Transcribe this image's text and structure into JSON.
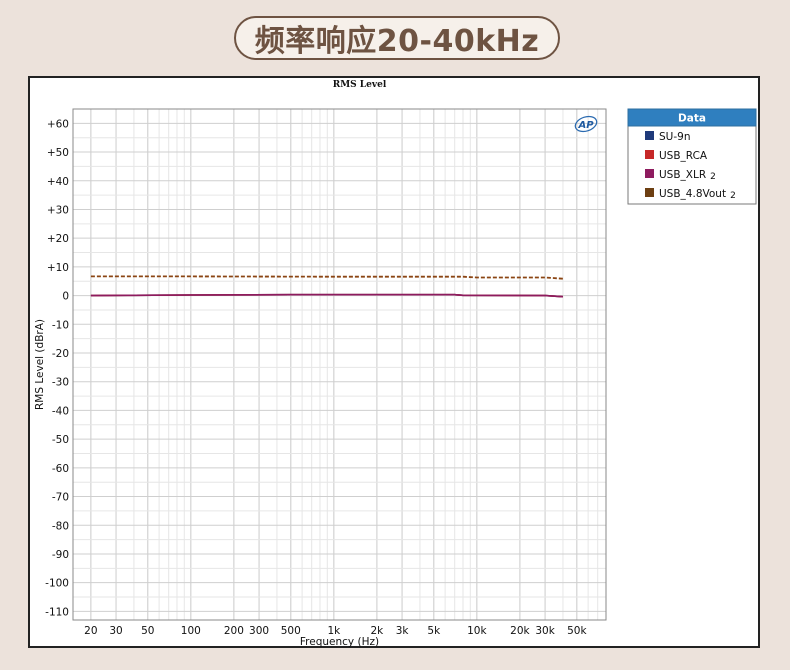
{
  "page": {
    "heading": "频率响应20-40kHz"
  },
  "chart_data": {
    "type": "line",
    "title": "RMS Level",
    "xlabel": "Frequency (Hz)",
    "ylabel": "RMS Level (dBrA)",
    "x_scale": "log",
    "xlim": [
      15,
      80000
    ],
    "ylim": [
      -113,
      65
    ],
    "grid": true,
    "legend_position": "outside-right",
    "logo_text": "AP",
    "x_ticks": [
      {
        "value": 20,
        "label": "20"
      },
      {
        "value": 30,
        "label": "30"
      },
      {
        "value": 50,
        "label": "50"
      },
      {
        "value": 100,
        "label": "100"
      },
      {
        "value": 200,
        "label": "200"
      },
      {
        "value": 300,
        "label": "300"
      },
      {
        "value": 500,
        "label": "500"
      },
      {
        "value": 1000,
        "label": "1k"
      },
      {
        "value": 2000,
        "label": "2k"
      },
      {
        "value": 3000,
        "label": "3k"
      },
      {
        "value": 5000,
        "label": "5k"
      },
      {
        "value": 10000,
        "label": "10k"
      },
      {
        "value": 20000,
        "label": "20k"
      },
      {
        "value": 30000,
        "label": "30k"
      },
      {
        "value": 50000,
        "label": "50k"
      }
    ],
    "y_ticks": [
      {
        "value": 60,
        "label": "+60"
      },
      {
        "value": 50,
        "label": "+50"
      },
      {
        "value": 40,
        "label": "+40"
      },
      {
        "value": 30,
        "label": "+30"
      },
      {
        "value": 20,
        "label": "+20"
      },
      {
        "value": 10,
        "label": "+10"
      },
      {
        "value": 0,
        "label": "0"
      },
      {
        "value": -10,
        "label": "-10"
      },
      {
        "value": -20,
        "label": "-20"
      },
      {
        "value": -30,
        "label": "-30"
      },
      {
        "value": -40,
        "label": "-40"
      },
      {
        "value": -50,
        "label": "-50"
      },
      {
        "value": -60,
        "label": "-60"
      },
      {
        "value": -70,
        "label": "-70"
      },
      {
        "value": -80,
        "label": "-80"
      },
      {
        "value": -90,
        "label": "-90"
      },
      {
        "value": -100,
        "label": "-100"
      },
      {
        "value": -110,
        "label": "-110"
      }
    ],
    "legend": {
      "title": "Data",
      "entries": [
        {
          "label": "SU-9n",
          "color": "#1f3a7a"
        },
        {
          "label": "USB_RCA",
          "color": "#c62828"
        },
        {
          "label": "USB_XLR",
          "suffix": "2",
          "color": "#8e1b5f"
        },
        {
          "label": "USB_4.8Vout",
          "suffix": "2",
          "color": "#6d3f12"
        }
      ]
    },
    "series": [
      {
        "name": "SU-9n",
        "color": "#1f3a7a",
        "dash": false,
        "x": [
          20,
          40,
          100,
          500,
          1000,
          7000,
          8000,
          30000,
          40000
        ],
        "y": [
          0.0,
          0.1,
          0.2,
          0.3,
          0.3,
          0.3,
          0.1,
          0.0,
          -0.4
        ]
      },
      {
        "name": "USB_RCA",
        "color": "#c62828",
        "dash": false,
        "x": [
          20,
          40,
          100,
          500,
          1000,
          7000,
          8000,
          30000,
          40000
        ],
        "y": [
          0.0,
          0.1,
          0.2,
          0.3,
          0.3,
          0.3,
          0.1,
          0.0,
          -0.4
        ]
      },
      {
        "name": "USB_XLR",
        "color": "#8e1b5f",
        "dash": false,
        "x": [
          20,
          40,
          100,
          500,
          1000,
          7000,
          8000,
          30000,
          40000
        ],
        "y": [
          0.0,
          0.1,
          0.2,
          0.3,
          0.3,
          0.3,
          0.1,
          0.0,
          -0.4
        ]
      },
      {
        "name": "USB_4.8Vout",
        "color": "#8b4513",
        "dash": true,
        "x": [
          20,
          50,
          100,
          1000,
          8000,
          10000,
          30000,
          40000
        ],
        "y": [
          6.7,
          6.7,
          6.7,
          6.6,
          6.6,
          6.3,
          6.3,
          5.9
        ]
      }
    ]
  }
}
